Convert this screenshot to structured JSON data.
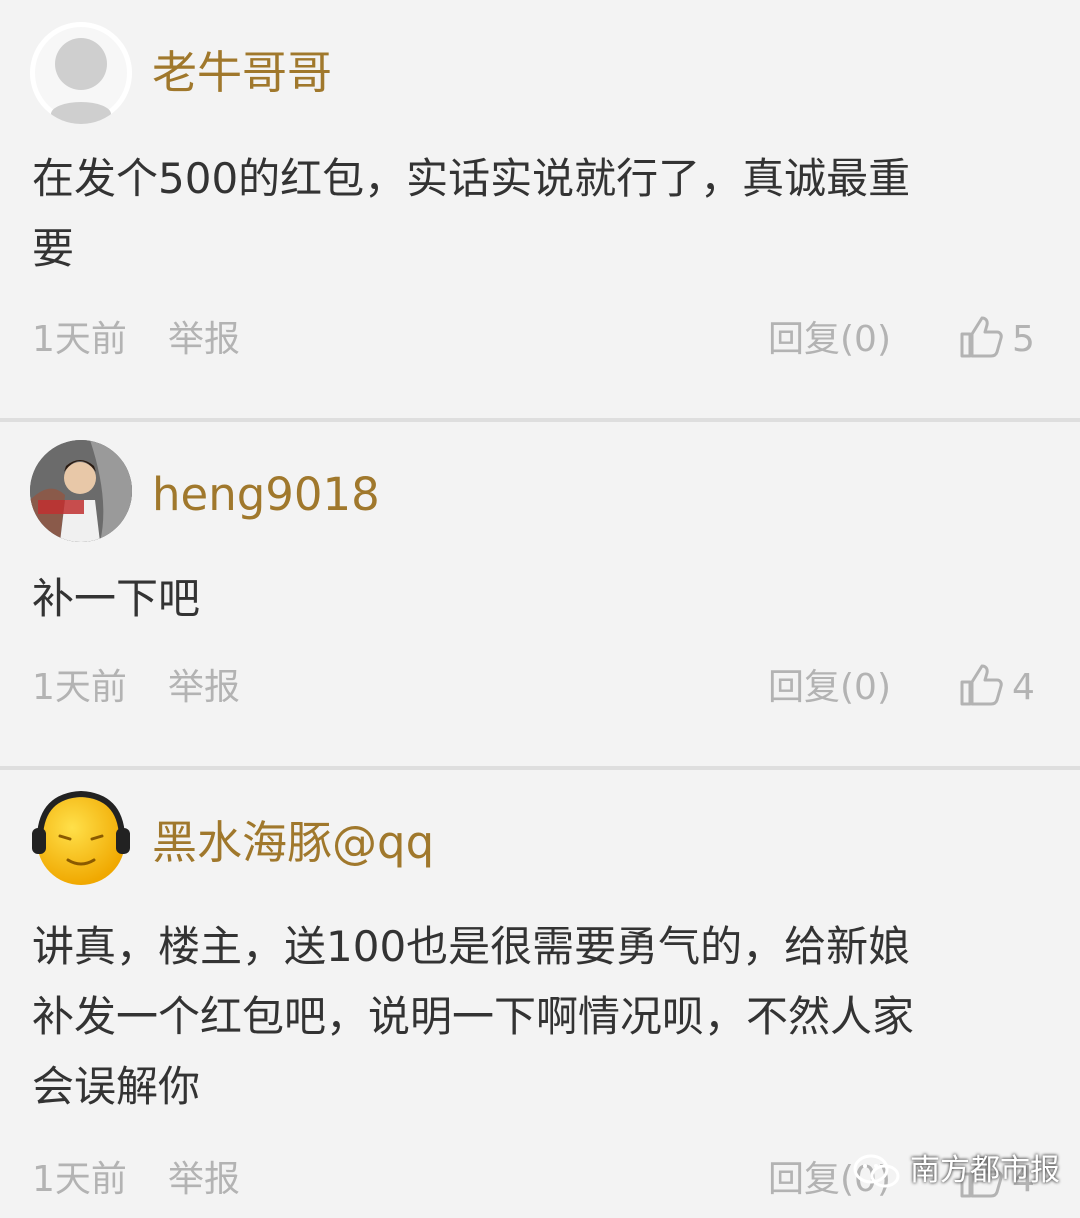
{
  "comments": [
    {
      "username": "老牛哥哥",
      "body_lines": [
        "在发个500的红包，实话实说就行了，真诚最重",
        "要"
      ],
      "time": "1天前",
      "report": "举报",
      "reply": "回复(0)",
      "likes": "5",
      "avatar": "default-avatar"
    },
    {
      "username": "heng9018",
      "body_lines": [
        "补一下吧"
      ],
      "time": "1天前",
      "report": "举报",
      "reply": "回复(0)",
      "likes": "4",
      "avatar": "anime-avatar"
    },
    {
      "username": "黑水海豚@qq",
      "body_lines": [
        "讲真，楼主，送100也是很需要勇气的，给新娘",
        "补发一个红包吧，说明一下啊情况呗，不然人家",
        "会误解你"
      ],
      "time": "1天前",
      "report": "举报",
      "reply": "回复(0)",
      "likes": "4",
      "avatar": "yellow-face-avatar"
    }
  ],
  "watermark": "南方都市报",
  "colors": {
    "username": "#a0782c",
    "text": "#333333",
    "meta": "#b3b3b3",
    "background": "#f3f3f3",
    "divider": "#dedede"
  }
}
